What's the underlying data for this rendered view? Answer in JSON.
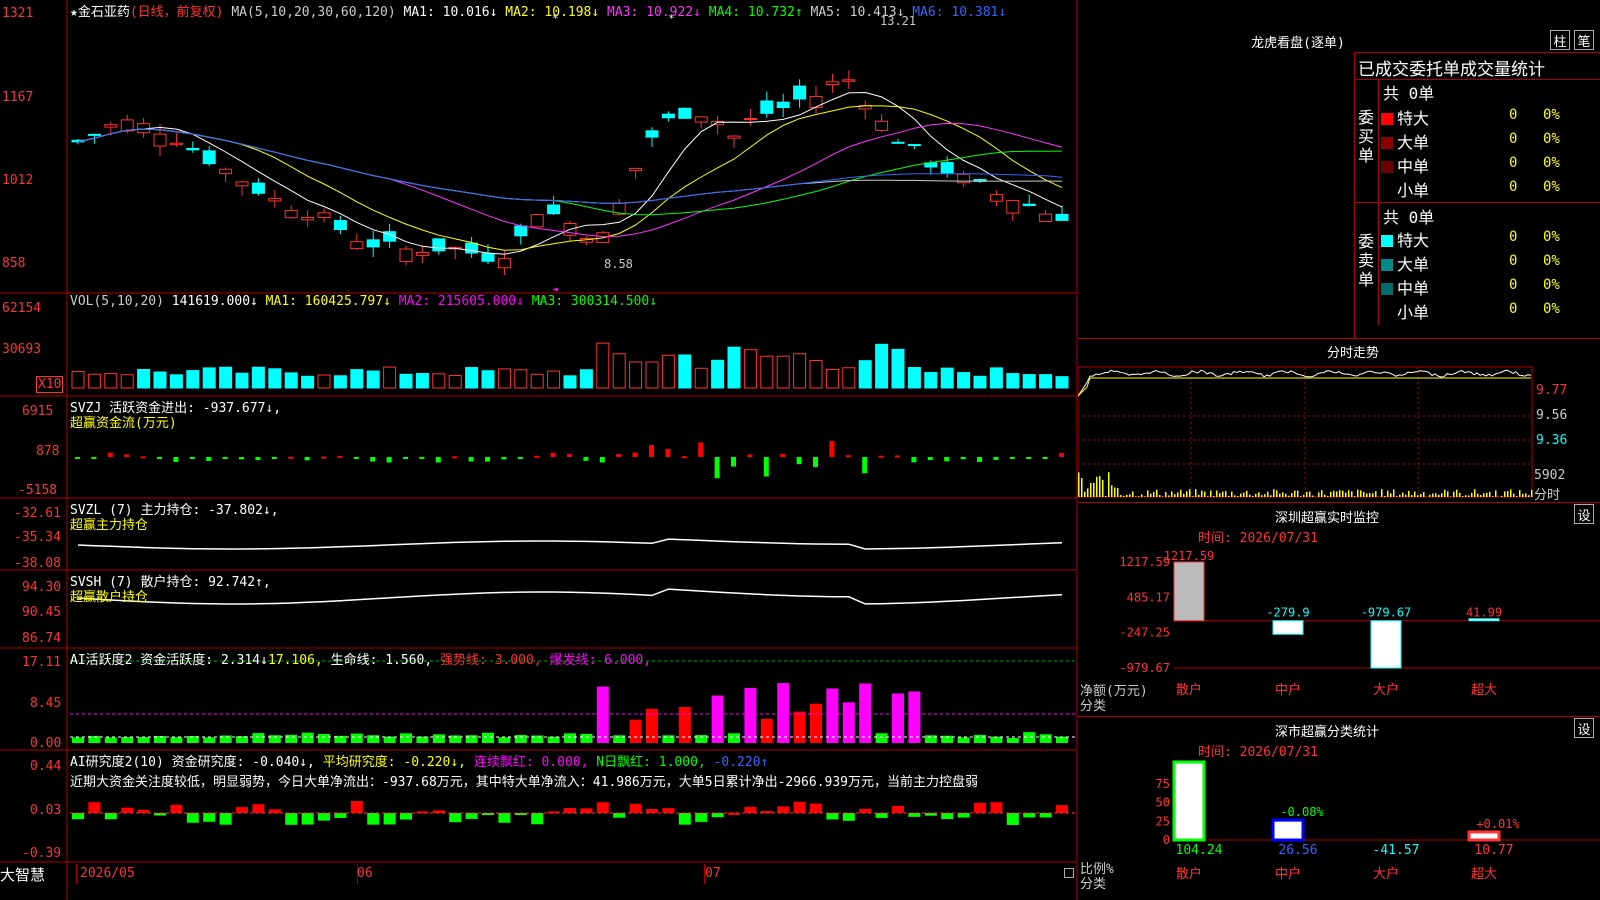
{
  "stock": {
    "star": "★",
    "name": "金石亚药",
    "period": "(日线，前复权)"
  },
  "ma": {
    "label": "MA(5,10,20,30,60,120)",
    "items": [
      {
        "name": "MA1:",
        "value": "10.016↓",
        "color": "#ffffff"
      },
      {
        "name": "MA2:",
        "value": "10.198↓",
        "color": "#ffff00"
      },
      {
        "name": "MA3:",
        "value": "10.922↓",
        "color": "#ff33ff"
      },
      {
        "name": "MA4:",
        "value": "10.732↑",
        "color": "#00ff00"
      },
      {
        "name": "MA5:",
        "value": "10.413↓",
        "color": "#cccccc"
      },
      {
        "name": "MA6:",
        "value": "10.381↓",
        "color": "#3366ff"
      }
    ]
  },
  "price_axis": [
    "1321",
    "1167",
    "1012",
    "858"
  ],
  "price_high": "13.21",
  "price_low": "8.58",
  "vol": {
    "label": "VOL(5,10,20)",
    "value": "141619.000↓",
    "ma1": "MA1: 160425.797↓",
    "ma2": "MA2: 215605.000↓",
    "ma3": "MA3: 300314.500↓",
    "axis": [
      "62154",
      "30693"
    ],
    "unit": "X10"
  },
  "svzj": {
    "line1": "SVZJ  活跃资金进出: -937.677↓,",
    "line2": "超赢资金流(万元)",
    "axis": [
      "6915",
      "878",
      "-5158"
    ]
  },
  "svzl": {
    "line1": "SVZL (7) 主力持仓: -37.802↓,",
    "line2": "超赢主力持仓",
    "axis": [
      "-32.61",
      "-35.34",
      "-38.08"
    ]
  },
  "svsh": {
    "line1": "SVSH (7) 散户持仓: 92.742↑,",
    "line2": "超赢散户持仓",
    "axis": [
      "94.30",
      "90.45",
      "86.74"
    ]
  },
  "ai2": {
    "label": "AI活跃度2 资金活跃度:",
    "value1": "2.314↓",
    "value2": "17.106,",
    "life": "生命线: 1.560,",
    "strong": "强势线: 3.000,",
    "burst": "爆发线: 6.000,",
    "axis": [
      "17.11",
      "8.45",
      "0.00"
    ]
  },
  "ai_research": {
    "label": "AI研究度2(10) 资金研究度: -0.040↓,",
    "avg": "平均研究度: -0.220↓,",
    "red": "连续飘红: 0.000,",
    "nred": "N日飘红: 1.000,",
    "neg": "-0.220↑",
    "axis": [
      "0.44",
      "0.03",
      "-0.39"
    ],
    "comment": "近期大资金关注度较低，明显弱势，今日大单净流出：-937.68万元，其中特大单净流入：41.986万元，大单5日累计净出-2966.939万元，当前主力控盘弱"
  },
  "date_axis": {
    "brand": "大智慧",
    "labels": [
      "2026/05",
      "06",
      "07"
    ]
  },
  "dragon": {
    "title": "龙虎看盘(逐单)",
    "btn_zhu": "柱",
    "btn_bi": "笔",
    "header": "已成交委托单成交量统计",
    "buy": {
      "side": "委买单",
      "total": "共 0单",
      "rows": [
        {
          "label": "特大",
          "count": "0",
          "pct": "0%",
          "color": "#ff0000"
        },
        {
          "label": "大单",
          "count": "0",
          "pct": "0%",
          "color": "#8b0000"
        },
        {
          "label": "中单",
          "count": "0",
          "pct": "0%",
          "color": "#6b0000"
        },
        {
          "label": "小单",
          "count": "0",
          "pct": "0%",
          "color": "#000000"
        }
      ]
    },
    "sell": {
      "side": "委卖单",
      "total": "共 0单",
      "rows": [
        {
          "label": "特大",
          "count": "0",
          "pct": "0%",
          "color": "#00ffff"
        },
        {
          "label": "大单",
          "count": "0",
          "pct": "0%",
          "color": "#008b8b"
        },
        {
          "label": "中单",
          "count": "0",
          "pct": "0%",
          "color": "#006b6b"
        },
        {
          "label": "小单",
          "count": "0",
          "pct": "0%",
          "color": "#000000"
        }
      ]
    }
  },
  "timeshare": {
    "title": "分时走势",
    "axis": [
      "9.77",
      "9.56",
      "9.36"
    ],
    "vol": "5902",
    "unit": "分时"
  },
  "monitor": {
    "title": "深圳超赢实时监控",
    "btn": "设",
    "time": "时间: 2026/07/31",
    "axis": [
      "1217.59",
      "485.17",
      "-247.25",
      "-979.67"
    ],
    "unit_label": "净额(万元)",
    "cat_label": "分类",
    "bars": [
      {
        "name": "散户",
        "value": 1217.59,
        "label": "1217.59"
      },
      {
        "name": "中户",
        "value": -279.9,
        "label": "-279.9"
      },
      {
        "name": "大户",
        "value": -979.67,
        "label": "-979.67"
      },
      {
        "name": "超大",
        "value": 41.99,
        "label": "41.99"
      }
    ]
  },
  "classify": {
    "title": "深市超赢分类统计",
    "btn": "设",
    "time": "时间: 2026/07/31",
    "axis": [
      "75",
      "50",
      "25",
      "0"
    ],
    "unit_label": "比例%",
    "cat_label": "分类",
    "bars": [
      {
        "name": "散户",
        "value": 104.24,
        "label": "104.24",
        "top": ""
      },
      {
        "name": "中户",
        "value": 26.56,
        "label": "26.56",
        "top": "-0.08%"
      },
      {
        "name": "大户",
        "value": -41.57,
        "label": "-41.57",
        "top": ""
      },
      {
        "name": "超大",
        "value": 10.77,
        "label": "10.77",
        "top": "+0.01%"
      }
    ]
  },
  "colors": {
    "up": "#ff3333",
    "down": "#00ffff",
    "grid": "#b00000",
    "green": "#00ff00",
    "magenta": "#ff00ff",
    "yellow": "#ffff00"
  }
}
